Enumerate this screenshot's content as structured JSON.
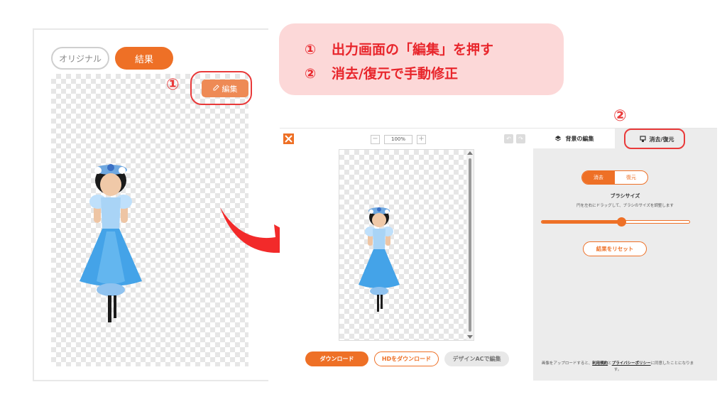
{
  "colors": {
    "accent": "#ee7026",
    "callout_red": "#e8252b",
    "ring_red": "#e93a3a",
    "callout_bg": "#fcd8d8"
  },
  "left_panel": {
    "tab_original": "オリジナル",
    "tab_result": "結果",
    "edit_button": "編集",
    "marker": "①"
  },
  "callout": {
    "step1_num": "①",
    "step1_text": "出力画面の「編集」を押す",
    "step2_num": "②",
    "step2_text": "消去/復元で手動修正"
  },
  "editor": {
    "zoom_minus": "−",
    "zoom_value": "100%",
    "zoom_plus": "+",
    "download": "ダウンロード",
    "download_hd": "HDをダウンロード",
    "design_ac": "デザインACで編集"
  },
  "sidebar": {
    "tab_bg_edit": "背景の編集",
    "tab_erase_restore": "消去/復元",
    "marker": "②",
    "seg_erase": "消去",
    "seg_restore": "復元",
    "brush_size_title": "ブラシサイズ",
    "brush_size_desc": "円を左右にドラッグして、ブラシのサイズを調整します",
    "brush_level": 0.54,
    "reset_button": "結果をリセット",
    "terms_prefix": "画像をアップロードすると、",
    "terms_link1": "利用規約",
    "terms_and": "と",
    "terms_link2": "プライバシーポリシー",
    "terms_suffix": "に同意したことになります。"
  }
}
